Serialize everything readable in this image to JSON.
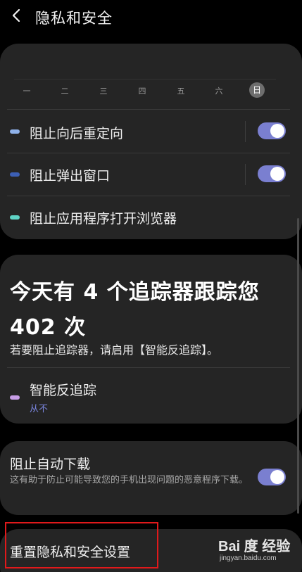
{
  "header": {
    "title": "隐私和安全"
  },
  "week": {
    "days": [
      "一",
      "二",
      "三",
      "四",
      "五",
      "六",
      "日"
    ],
    "selected_index": 6
  },
  "settings": {
    "block_redirect": {
      "label": "阻止向后重定向",
      "enabled": true,
      "dot_color": "#8fb2ea"
    },
    "block_popups": {
      "label": "阻止弹出窗口",
      "enabled": true,
      "dot_color": "#3c5fb4"
    },
    "block_apps_open_browser": {
      "label": "阻止应用程序打开浏览器",
      "dot_color": "#5fd3c5"
    }
  },
  "trackers": {
    "title_line1": "今天有 4 个追踪器跟踪您",
    "title_line2": "402 次",
    "hint": "若要阻止追踪器，请启用【智能反追踪】。",
    "smart_anti_tracking": {
      "label": "智能反追踪",
      "value": "从不",
      "dot_color": "#c79de6"
    }
  },
  "auto_download": {
    "title": "阻止自动下载",
    "description": "这有助于防止可能导致您的手机出现问题的恶意程序下载。",
    "enabled": true
  },
  "reset": {
    "label": "重置隐私和安全设置"
  },
  "watermark": {
    "brand": "Bai 度 经验",
    "url": "jingyan.baidu.com"
  },
  "colors": {
    "toggle_on": "#7a7fd0",
    "card_bg": "#252525",
    "page_bg": "#000000",
    "accent_link": "#7b86e0",
    "highlight": "#e0191b"
  }
}
